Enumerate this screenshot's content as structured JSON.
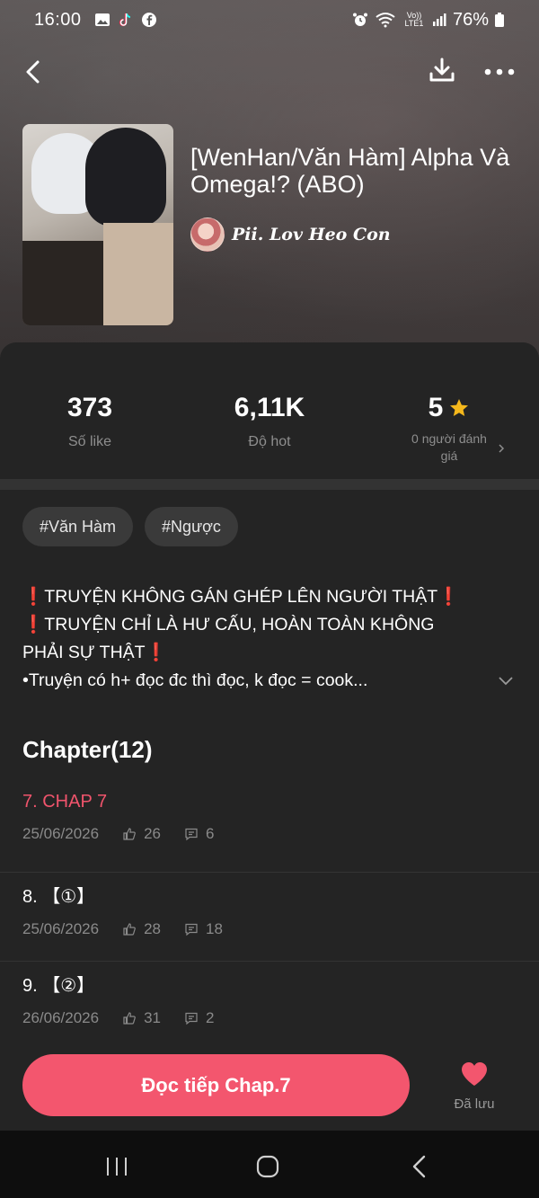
{
  "status_bar": {
    "time": "16:00",
    "left_icons": [
      "gallery-icon",
      "tiktok-icon",
      "facebook-icon"
    ],
    "right_icons": [
      "alarm-icon",
      "wifi-icon",
      "volte-icon",
      "signal-icon",
      "battery-icon"
    ],
    "volte_label": "Vo)) LTE1",
    "battery": "76%"
  },
  "header": {
    "back_icon": "back-arrow-icon",
    "download_icon": "download-icon",
    "more_icon": "more-dots-icon"
  },
  "story": {
    "title": "[WenHan/Văn Hàm] Alpha Và Omega!? (ABO)",
    "author": "Pii. Lov Heo Con"
  },
  "stats": {
    "likes_value": "373",
    "likes_label": "Số like",
    "hot_value": "6,11K",
    "hot_label": "Độ hot",
    "rating_value": "5",
    "rating_label_line1": "0 người đánh",
    "rating_label_line2": "giá"
  },
  "tags": [
    "#Văn Hàm",
    "#Ngược"
  ],
  "description": {
    "line1": "TRUYỆN KHÔNG GÁN GHÉP LÊN NGƯỜI THẬT",
    "line2": "TRUYỆN CHỈ LÀ HƯ CẤU, HOÀN TOÀN KHÔNG",
    "line3": "PHẢI SỰ THẬT",
    "line4": "•Truyện có h+ đọc đc thì đọc, k đọc = cook...",
    "warn_mark": "❗"
  },
  "chapters_section": {
    "title": "Chapter(12)",
    "items": [
      {
        "name": "7. CHAP 7",
        "date": "25/06/2026",
        "likes": "26",
        "comments": "6",
        "active": true
      },
      {
        "name": "8. 【①】",
        "date": "25/06/2026",
        "likes": "28",
        "comments": "18",
        "active": false
      },
      {
        "name": "9. 【②】",
        "date": "26/06/2026",
        "likes": "31",
        "comments": "2",
        "active": false
      }
    ]
  },
  "bottom": {
    "read_button": "Đọc tiếp Chap.7",
    "save_label": "Đã lưu"
  },
  "colors": {
    "accent": "#f3566e",
    "active_chapter": "#f0546c",
    "star": "#f5b81c",
    "panel": "#242424"
  }
}
